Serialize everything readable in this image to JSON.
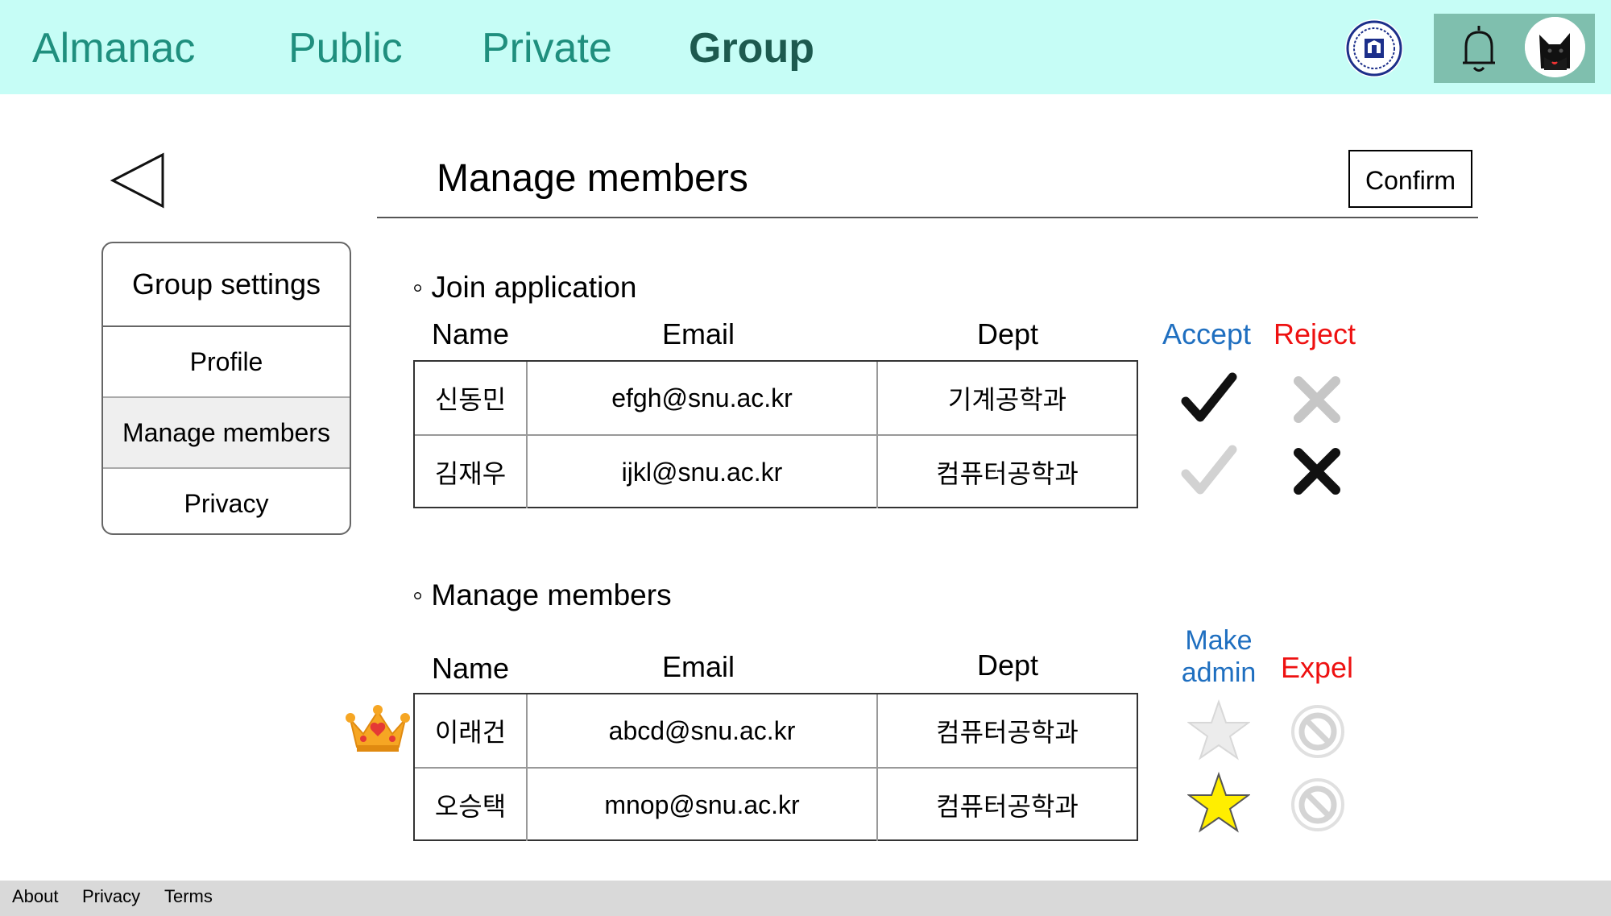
{
  "nav": {
    "brand": "Almanac",
    "links": [
      "Public",
      "Private",
      "Group"
    ],
    "active": "Group",
    "icons": {
      "logo": "university-seal-icon",
      "bell": "bell-icon",
      "avatar": "black-cat-avatar"
    }
  },
  "header": {
    "title": "Manage members",
    "confirm_label": "Confirm",
    "back_icon": "triangle-left-icon"
  },
  "sidebar": {
    "title": "Group settings",
    "items": [
      {
        "label": "Profile",
        "active": false
      },
      {
        "label": "Manage members",
        "active": true
      },
      {
        "label": "Privacy",
        "active": false
      }
    ]
  },
  "join": {
    "section_label": "◦ Join application",
    "headers": {
      "name": "Name",
      "email": "Email",
      "dept": "Dept",
      "accept": "Accept",
      "reject": "Reject"
    },
    "rows": [
      {
        "name": "신동민",
        "email": "efgh@snu.ac.kr",
        "dept": "기계공학과",
        "accept_state": "selected",
        "reject_state": "unselected"
      },
      {
        "name": "김재우",
        "email": "ijkl@snu.ac.kr",
        "dept": "컴퓨터공학과",
        "accept_state": "unselected",
        "reject_state": "selected"
      }
    ]
  },
  "members": {
    "section_label": "◦ Manage members",
    "headers": {
      "name": "Name",
      "email": "Email",
      "dept": "Dept",
      "admin_line1": "Make",
      "admin_line2": "admin",
      "expel": "Expel"
    },
    "rows": [
      {
        "name": "이래건",
        "email": "abcd@snu.ac.kr",
        "dept": "컴퓨터공학과",
        "owner": true,
        "admin": false
      },
      {
        "name": "오승택",
        "email": "mnop@snu.ac.kr",
        "dept": "컴퓨터공학과",
        "owner": false,
        "admin": true
      }
    ]
  },
  "footer": {
    "links": [
      "About",
      "Privacy",
      "Terms"
    ]
  },
  "colors": {
    "topbar": "#c6fdf6",
    "nav_text": "#1f8f7e",
    "nav_active": "#1d5a4f",
    "tools_bg": "#7fbfae",
    "accept": "#1f6fc0",
    "reject": "#e11111",
    "star_on": "#ffee00",
    "inactive": "#d0d0d0"
  }
}
